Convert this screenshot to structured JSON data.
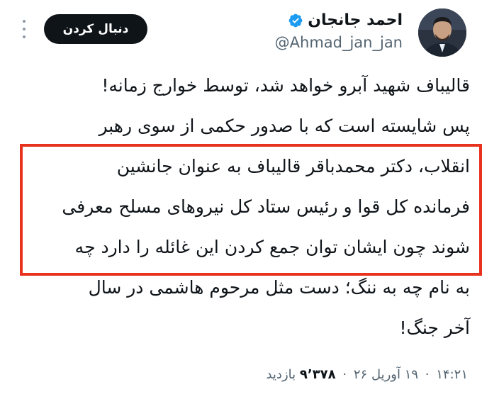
{
  "author": {
    "display_name": "احمد جانجان",
    "handle": "@Ahmad_jan_jan",
    "verified": true,
    "avatar_icon": "profile-photo"
  },
  "actions": {
    "follow_label": "دنبال کردن",
    "more_icon": "more-vertical-icon"
  },
  "tweet": {
    "lines": [
      "قالیباف شهید آبرو خواهد شد، توسط خوارج زمانه!",
      "پس شایسته است که با صدور حکمی از سوی رهبر",
      "انقلاب، دکتر محمدباقر قالیباف به عنوان جانشین",
      "فرمانده کل قوا و رئیس ستاد کل نیروهای مسلح معرفی",
      "شوند چون ایشان توان جمع کردن این غائله را دارد چه",
      "به نام چه به ننگ؛ د‌ست مثل مرحوم هاشمی در سال",
      "آخر جنگ!"
    ],
    "highlight_color": "#e8321e"
  },
  "meta": {
    "time": "۱۴:۲۱",
    "date": "۱۹ آوریل ۲۶",
    "views_count": "۹٬۳۷۸",
    "views_label": "بازدید",
    "separator": "·"
  },
  "colors": {
    "text": "#0f1419",
    "muted": "#536471",
    "verified_blue": "#1d9bf0",
    "button_bg": "#0f1419"
  }
}
